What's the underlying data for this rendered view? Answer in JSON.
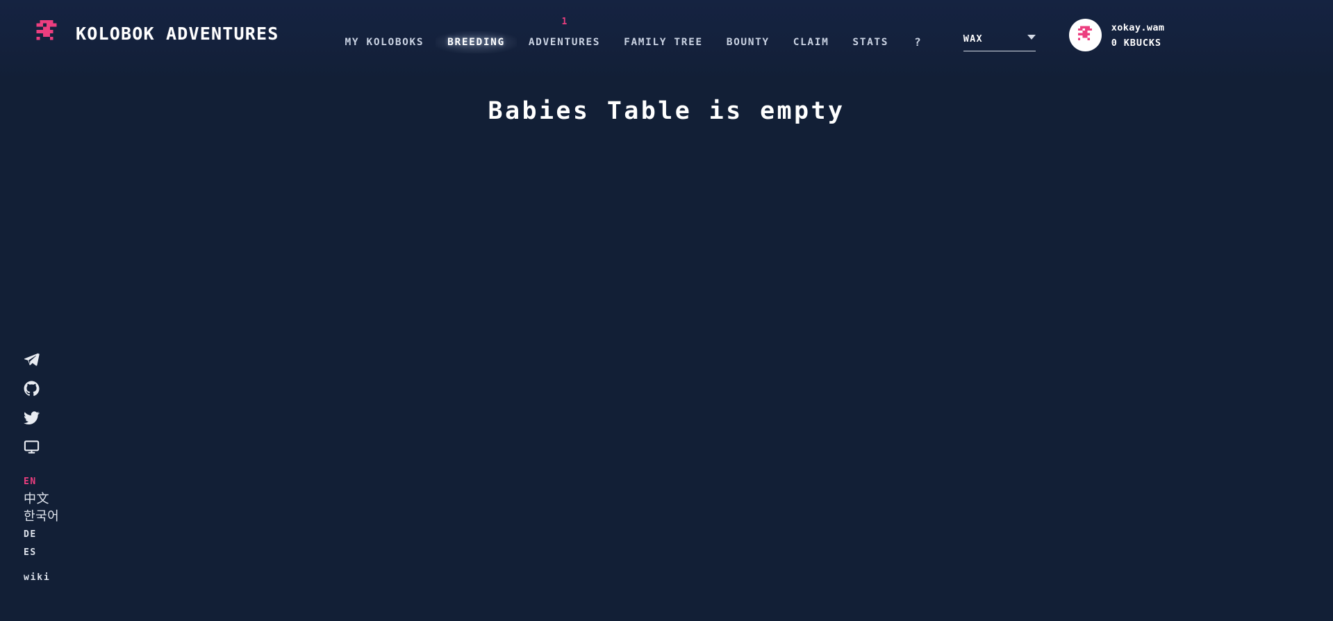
{
  "page": {
    "background_color": "#121f36",
    "accent_color": "#ec3e7f",
    "text_color": "#ffffff"
  },
  "header": {
    "brand": {
      "title": "KOLOBOK ADVENTURES",
      "logo_icon": "kolobok-pixel-logo-icon"
    },
    "nav_items": [
      {
        "label": "MY KOLOBOKS",
        "active": false,
        "badge": null
      },
      {
        "label": "BREEDING",
        "active": true,
        "badge": null
      },
      {
        "label": "ADVENTURES",
        "active": false,
        "badge": "1"
      },
      {
        "label": "FAMILY TREE",
        "active": false,
        "badge": null
      },
      {
        "label": "BOUNTY",
        "active": false,
        "badge": null
      },
      {
        "label": "CLAIM",
        "active": false,
        "badge": null
      },
      {
        "label": "STATS",
        "active": false,
        "badge": null
      },
      {
        "label": "?",
        "active": false,
        "badge": null
      }
    ],
    "chain_select": {
      "value": "WAX",
      "caret_icon": "chevron-down-icon"
    },
    "account": {
      "avatar_icon": "kolobok-avatar-icon",
      "name": "xokay.wam",
      "balance": "0 KBUCKS"
    }
  },
  "main": {
    "empty_message": "Babies Table is empty"
  },
  "sidebar": {
    "socials": [
      {
        "name": "telegram-icon",
        "label": "Telegram"
      },
      {
        "name": "github-icon",
        "label": "GitHub"
      },
      {
        "name": "twitter-icon",
        "label": "Twitter"
      },
      {
        "name": "monitor-icon",
        "label": "Monitor"
      }
    ],
    "languages": [
      {
        "label": "EN",
        "active": true,
        "script": "latin"
      },
      {
        "label": "中文",
        "active": false,
        "script": "cjk"
      },
      {
        "label": "한국어",
        "active": false,
        "script": "cjk"
      },
      {
        "label": "DE",
        "active": false,
        "script": "latin"
      },
      {
        "label": "ES",
        "active": false,
        "script": "latin"
      }
    ],
    "wiki_label": "wiki"
  }
}
